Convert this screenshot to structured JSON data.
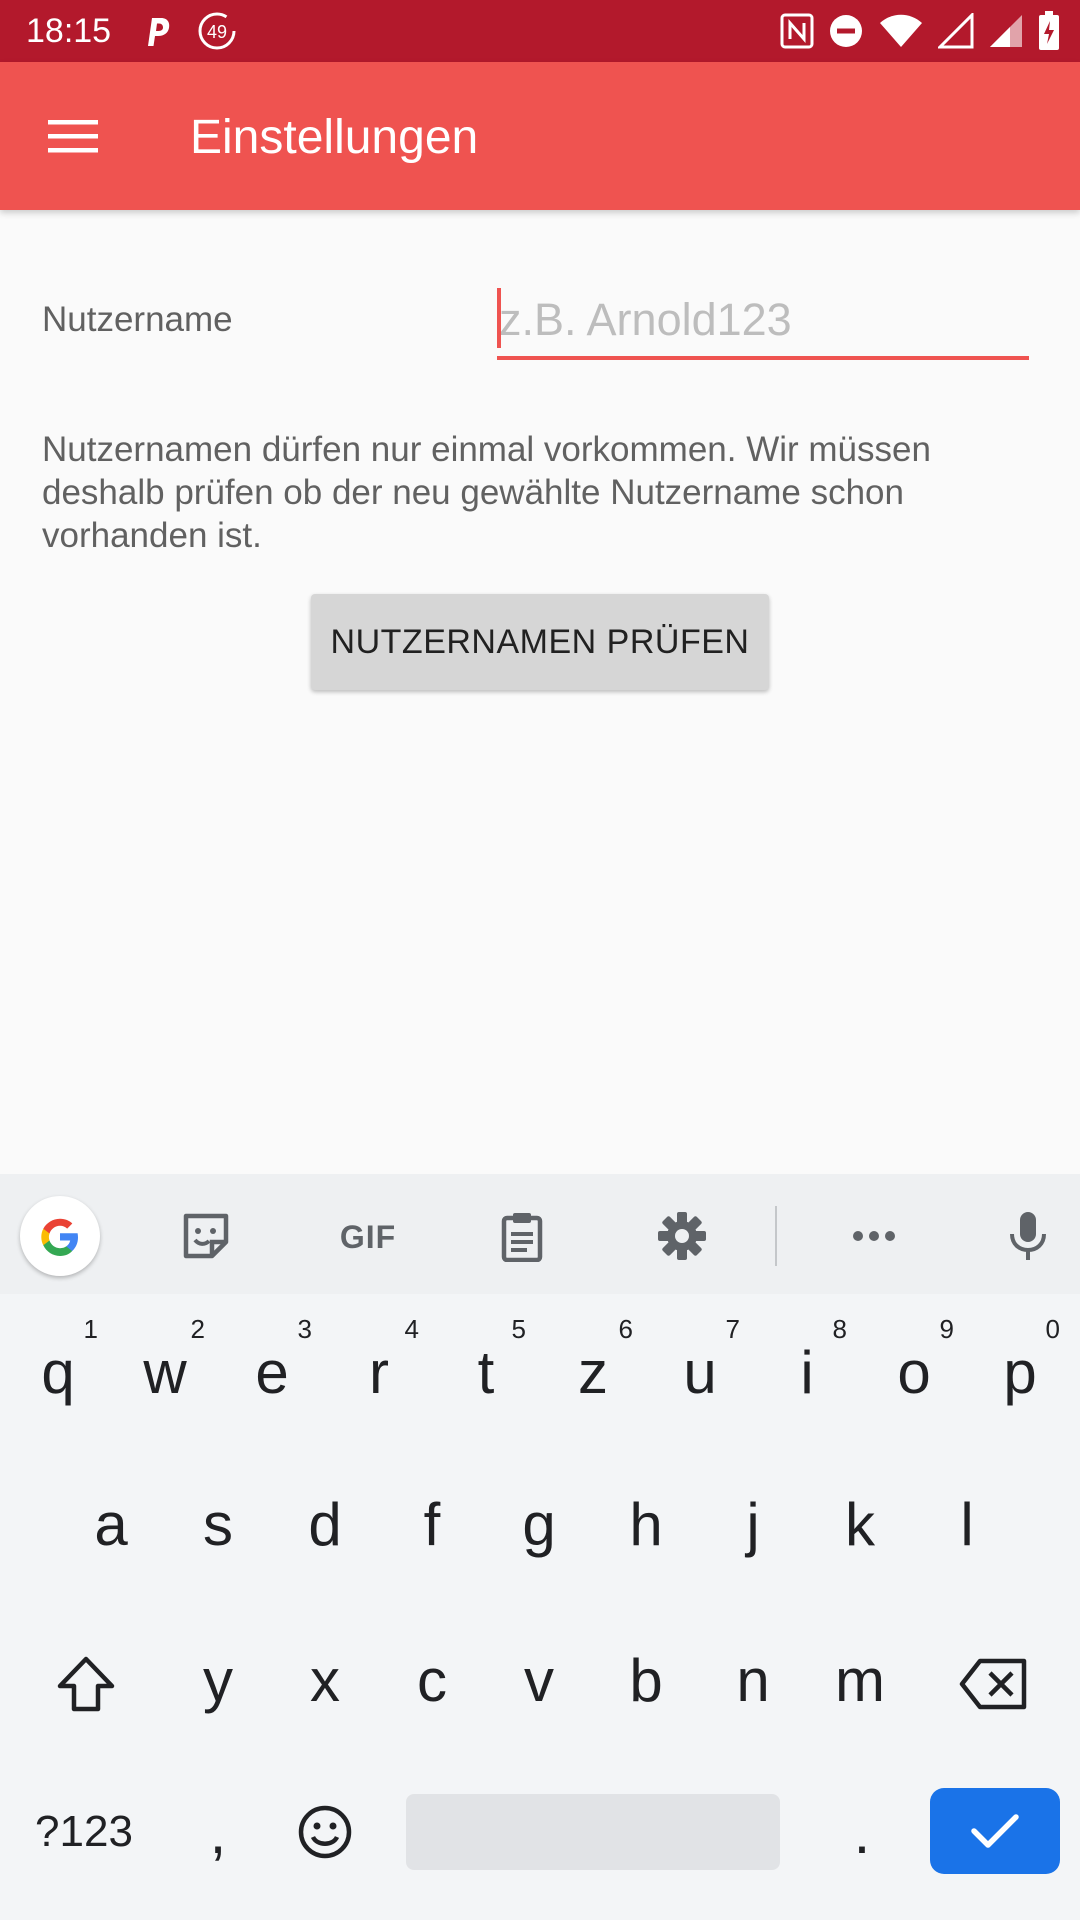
{
  "status_bar": {
    "time": "18:15",
    "notification_badge": "49",
    "icons": [
      "parking-icon",
      "timer-49-icon",
      "nfc-icon",
      "do-not-disturb-icon",
      "wifi-icon",
      "signal-icon",
      "signal-icon-2",
      "battery-charging-icon"
    ],
    "background_color": "#b3192c"
  },
  "app_bar": {
    "title": "Einstellungen",
    "menu_icon": "hamburger-menu-icon",
    "background_color": "#ef5350"
  },
  "settings": {
    "username_label": "Nutzername",
    "username_value": "",
    "username_placeholder": "z.B. Arnold123",
    "info_text": "Nutzernamen dürfen nur einmal vorkommen. Wir müssen deshalb prüfen ob der neu gewählte Nutzername schon vorhanden ist.",
    "check_button_label": "NUTZERNAMEN PRÜFEN",
    "accent_color": "#ef5350"
  },
  "keyboard": {
    "toolbar_icons": [
      "google-g-icon",
      "sticker-icon",
      "gif-icon",
      "clipboard-icon",
      "settings-gear-icon",
      "more-dots-icon",
      "microphone-icon"
    ],
    "gif_label": "GIF",
    "row1": [
      {
        "key": "q",
        "hint": "1"
      },
      {
        "key": "w",
        "hint": "2"
      },
      {
        "key": "e",
        "hint": "3"
      },
      {
        "key": "r",
        "hint": "4"
      },
      {
        "key": "t",
        "hint": "5"
      },
      {
        "key": "z",
        "hint": "6"
      },
      {
        "key": "u",
        "hint": "7"
      },
      {
        "key": "i",
        "hint": "8"
      },
      {
        "key": "o",
        "hint": "9"
      },
      {
        "key": "p",
        "hint": "0"
      }
    ],
    "row2": [
      "a",
      "s",
      "d",
      "f",
      "g",
      "h",
      "j",
      "k",
      "l"
    ],
    "row3": [
      "y",
      "x",
      "c",
      "v",
      "b",
      "n",
      "m"
    ],
    "symbols_key": "?123",
    "comma_key": ",",
    "period_key": ".",
    "shift_icon": "shift-icon",
    "backspace_icon": "backspace-icon",
    "emoji_icon": "emoji-icon",
    "enter_icon": "checkmark-icon",
    "enter_color": "#1a73e8"
  }
}
